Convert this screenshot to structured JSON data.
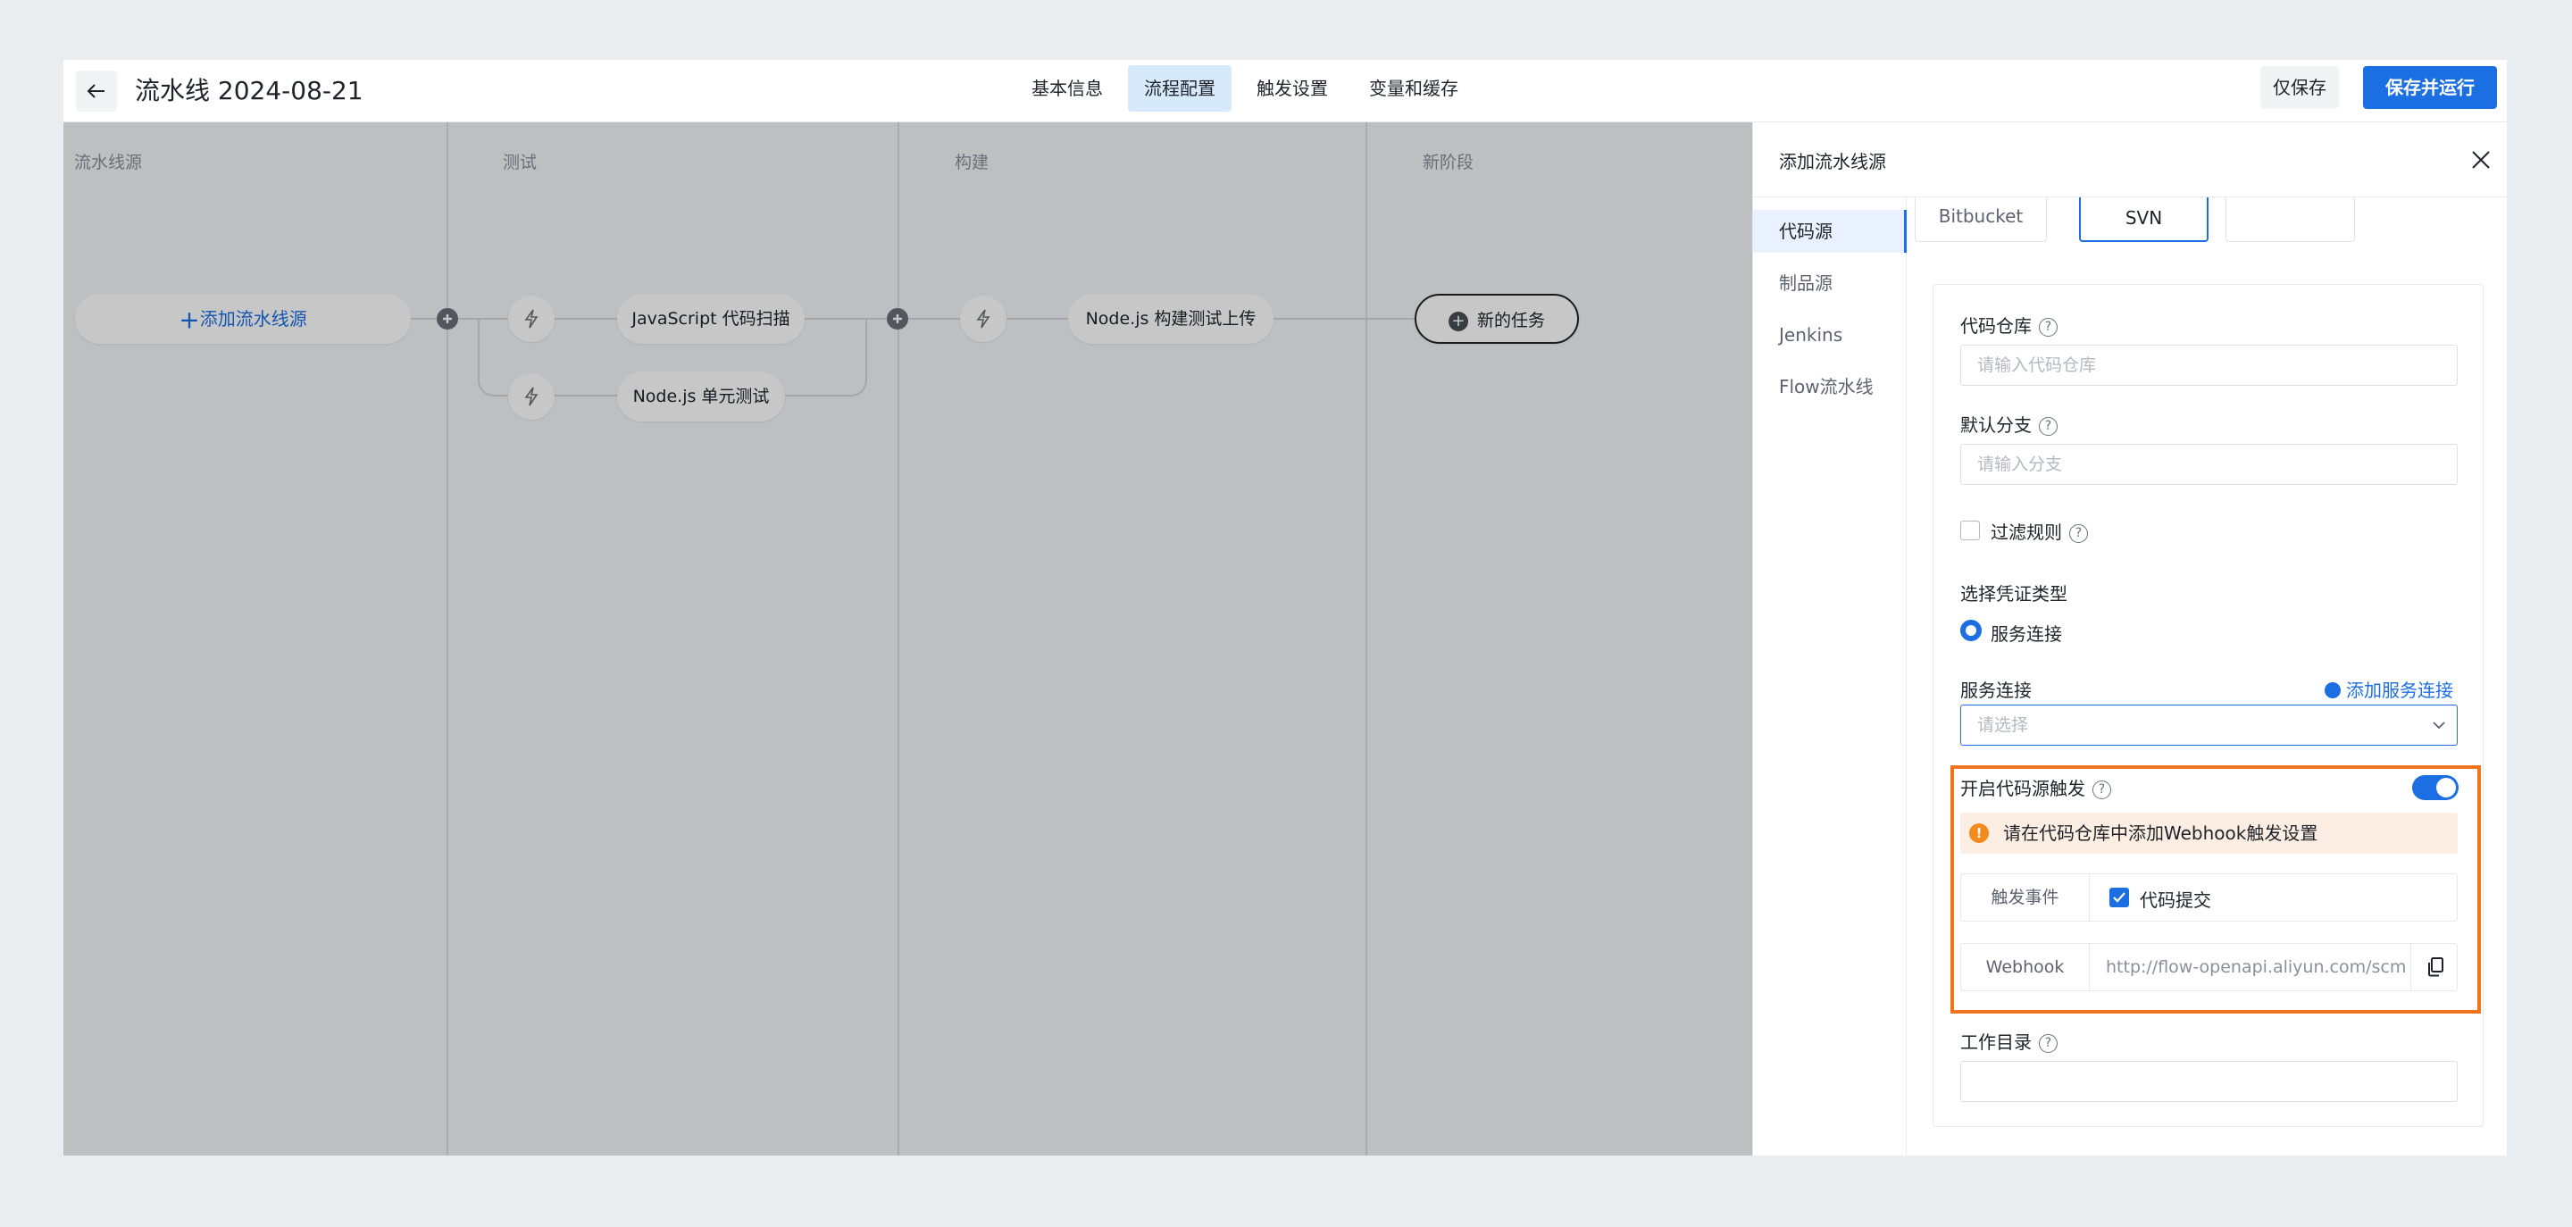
{
  "header": {
    "title": "流水线 2024-08-21",
    "tabs": [
      "基本信息",
      "流程配置",
      "触发设置",
      "变量和缓存"
    ],
    "active_tab": "流程配置",
    "save_only_label": "仅保存",
    "save_run_label": "保存并运行"
  },
  "pipeline": {
    "stages": [
      "流水线源",
      "测试",
      "构建",
      "新阶段"
    ],
    "add_source_label": "添加流水线源",
    "test_jobs": [
      "JavaScript 代码扫描",
      "Node.js 单元测试"
    ],
    "build_jobs": [
      "Node.js 构建测试上传"
    ],
    "new_task_label": "新的任务"
  },
  "drawer": {
    "title": "添加流水线源",
    "nav": [
      "代码源",
      "制品源",
      "Jenkins",
      "Flow流水线"
    ],
    "active_nav": "代码源",
    "source_tiles": [
      "Bitbucket",
      "SVN",
      ""
    ],
    "active_source": "SVN",
    "form": {
      "repo_label": "代码仓库",
      "repo_placeholder": "请输入代码仓库",
      "branch_label": "默认分支",
      "branch_placeholder": "请输入分支",
      "filter_label": "过滤规则",
      "filter_checked": false,
      "credential_label": "选择凭证类型",
      "credential_option": "服务连接",
      "service_label": "服务连接",
      "add_service_label": "添加服务连接",
      "service_placeholder": "请选择",
      "trigger_label": "开启代码源触发",
      "trigger_enabled": true,
      "warning_text": "请在代码仓库中添加Webhook触发设置",
      "event_key": "触发事件",
      "event_option": "代码提交",
      "event_checked": true,
      "webhook_key": "Webhook",
      "webhook_value": "http://flow-openapi.aliyun.com/scm",
      "workdir_label": "工作目录"
    }
  },
  "colors": {
    "accent": "#1b6fe2",
    "highlight": "#f0741e",
    "warning_bg": "#fdeee3"
  }
}
